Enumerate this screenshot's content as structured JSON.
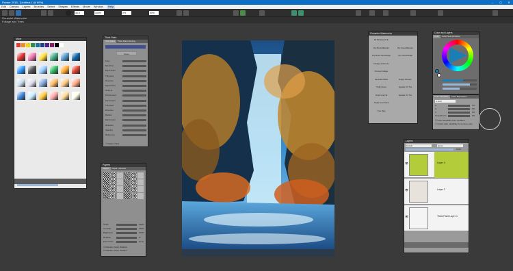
{
  "window": {
    "title": "Painter 2018 - [Untitled-1 @ 50%]"
  },
  "menu": [
    "Edit",
    "Canvas",
    "Layers",
    "Brushes",
    "Select",
    "Shapes",
    "Effects",
    "Movie",
    "Window",
    "Help"
  ],
  "menu_active": "Help",
  "brush": {
    "category": "Gouache Watercolor",
    "variant": "Foliage and Trees"
  },
  "toolbar": {
    "size": "30.0",
    "opacity": "100%",
    "grain": "0%",
    "zoom": "50%"
  },
  "panels": {
    "mixer": {
      "title": "Mixer"
    },
    "thick_paint": {
      "title": "Thick Paint",
      "tabs": [
        "Thick Paint",
        "Thick Paint Cloning"
      ],
      "button": "Reset",
      "sections": [
        "Deposit",
        "Canvas",
        "Gradient"
      ],
      "rows": [
        "Flow",
        "Min Flow",
        "Expression",
        "Thinness",
        "Direction",
        "Expression",
        "Amount",
        "Min Amount",
        "Expression",
        "Thinness",
        "Direction",
        "Radius",
        "Expression",
        "Direction",
        "Spacing",
        "Reference"
      ],
      "checkbox": "Flatten Paint"
    },
    "papers": {
      "title": "Papers",
      "tabs": [
        "Papers",
        "Paper Libraries"
      ],
      "sliders": [
        "Scale",
        "Contrast",
        "Brightness",
        "Rotation",
        "Expression"
      ],
      "values": [
        "100%",
        "100%",
        "100%",
        "0°",
        "None"
      ],
      "checks": [
        "Random Grain Rotation",
        "Random Grain Position"
      ]
    },
    "brush_library": {
      "title": "Gouache Watercolor",
      "items": [
        [
          "All Painting Knife",
          ""
        ],
        [
          "Dry Brush Blender",
          "Dry Cloud Blender"
        ],
        [
          "Dry Brush Landscape",
          "Dry Cloud Detail"
        ],
        [
          "Foliage and Trees",
          ""
        ],
        [
          "Frosted Foliage",
          ""
        ],
        [
          "Mountain Mists",
          "Happy Flowers"
        ],
        [
          "Puffy Cloud",
          "Sparkle On The"
        ],
        [
          "Script Liner W",
          "Sparkle On The"
        ],
        [
          "Script Liner Thick",
          ""
        ],
        [
          "Tree Bark",
          ""
        ]
      ]
    },
    "color": {
      "title": "Color and Layers",
      "tabs": [
        "Color",
        "Color Sets Libraries"
      ]
    },
    "color_variability": {
      "tabs": [
        "Color Variability",
        "Color Expression"
      ],
      "mode": "In HSV",
      "rows": [
        "H",
        "S",
        "V",
        "Smoothness"
      ],
      "values": [
        "0%",
        "0%",
        "0%",
        "0%"
      ],
      "checks": [
        "Color Variability from Gradient",
        "Inherit color variability from clone color"
      ]
    },
    "layers": {
      "title": "Layers",
      "composite": "Default",
      "opacity_label": "Ignore",
      "opacity_value": "100%",
      "rows": [
        {
          "name": "Layer 3",
          "thumb": "#b3cc3a"
        },
        {
          "name": "Layer 2",
          "thumb": "#e8e2dc"
        },
        {
          "name": "Thick Paint Layer 1",
          "thumb": "#f4f4f4"
        }
      ]
    }
  },
  "colors": {
    "accent": "#0d6fc4",
    "palette": [
      "#e53a2f",
      "#f08c20",
      "#f0d419",
      "#2a9146",
      "#19739c",
      "#1d3d92",
      "#4a2580",
      "#8a1c63",
      "#000000",
      "#ffffff"
    ]
  }
}
